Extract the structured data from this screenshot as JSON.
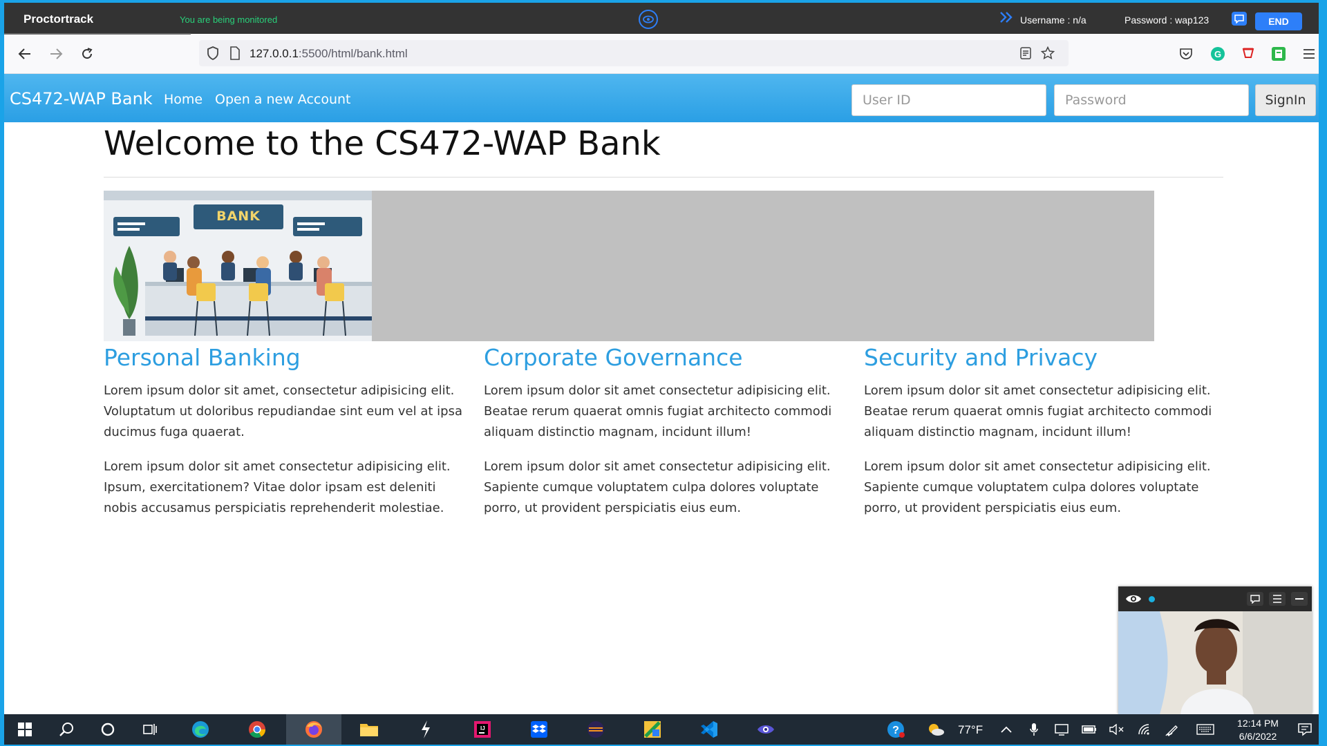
{
  "proctor": {
    "brand": "Proctortrack",
    "monitor_text": "You are being monitored",
    "username": "Username : n/a",
    "password": "Password : wap123",
    "end_label": "END"
  },
  "browser": {
    "url_host": "127.0.0.1",
    "url_port_path": ":5500/html/bank.html"
  },
  "site": {
    "brand": "CS472-WAP Bank",
    "nav": [
      "Home",
      "Open a new Account"
    ],
    "userid_placeholder": "User ID",
    "password_placeholder": "Password",
    "signin_label": "SignIn",
    "title": "Welcome to the CS472-WAP Bank",
    "banner_sign": "BANK",
    "columns": [
      {
        "heading": "Personal Banking",
        "p1": "Lorem ipsum dolor sit amet, consectetur adipisicing elit. Voluptatum ut doloribus repudiandae sint eum vel at ipsa ducimus fuga quaerat.",
        "p2": "Lorem ipsum dolor sit amet consectetur adipisicing elit. Ipsum, exercitationem? Vitae dolor ipsam est deleniti nobis accusamus perspiciatis reprehenderit molestiae."
      },
      {
        "heading": "Corporate Governance",
        "p1": "Lorem ipsum dolor sit amet consectetur adipisicing elit. Beatae rerum quaerat omnis fugiat architecto commodi aliquam distinctio magnam, incidunt illum!",
        "p2": "Lorem ipsum dolor sit amet consectetur adipisicing elit. Sapiente cumque voluptatem culpa dolores voluptate porro, ut provident perspiciatis eius eum."
      },
      {
        "heading": "Security and Privacy",
        "p1": "Lorem ipsum dolor sit amet consectetur adipisicing elit. Beatae rerum quaerat omnis fugiat architecto commodi aliquam distinctio magnam, incidunt illum!",
        "p2": "Lorem ipsum dolor sit amet consectetur adipisicing elit. Sapiente cumque voluptatem culpa dolores voluptate porro, ut provident perspiciatis eius eum."
      }
    ]
  },
  "taskbar": {
    "weather": "77°F",
    "time": "12:14 PM",
    "date": "6/6/2022"
  },
  "colors": {
    "nav_blue": "#2a9fe5",
    "heading_blue": "#2d9ee0",
    "proctor_accent": "#2d7ff9",
    "monitor_green": "#29d17a"
  }
}
